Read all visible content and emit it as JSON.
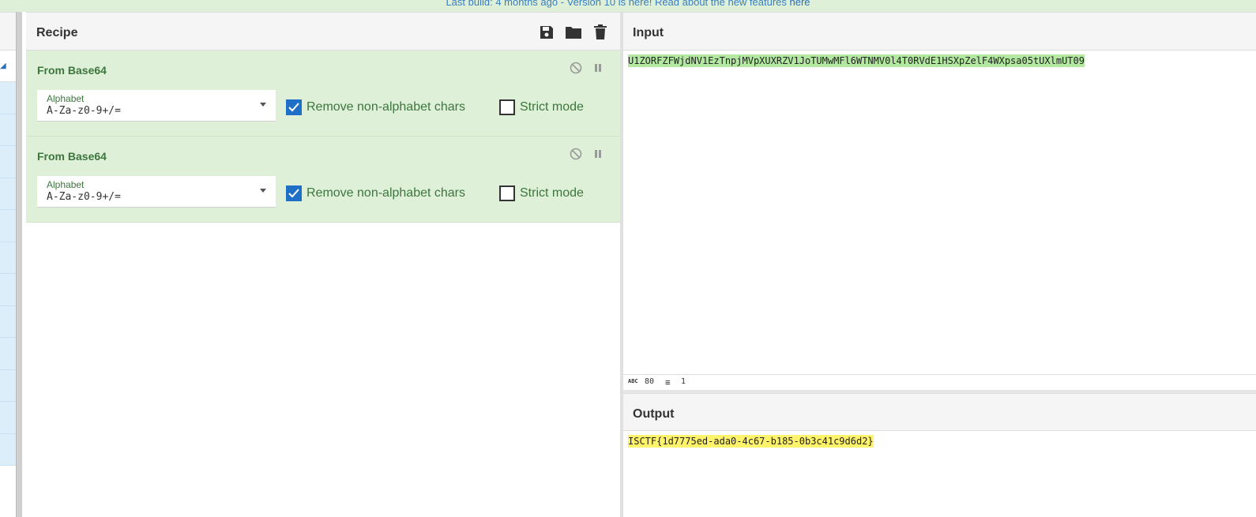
{
  "banner": {
    "text": "Last build: 4 months ago - Version 10 is here! Read about the new features ",
    "link": "here"
  },
  "recipe": {
    "title": "Recipe",
    "actions": [
      "save-icon",
      "folder-icon",
      "trash-icon"
    ],
    "operations": [
      {
        "name": "From Base64",
        "alphabet_label": "Alphabet",
        "alphabet_value": "A-Za-z0-9+/=",
        "remove_label": "Remove non-alphabet chars",
        "remove_checked": true,
        "strict_label": "Strict mode",
        "strict_checked": false
      },
      {
        "name": "From Base64",
        "alphabet_label": "Alphabet",
        "alphabet_value": "A-Za-z0-9+/=",
        "remove_label": "Remove non-alphabet chars",
        "remove_checked": true,
        "strict_label": "Strict mode",
        "strict_checked": false
      }
    ]
  },
  "input": {
    "title": "Input",
    "text": "U1ZORFZFWjdNV1EzTnpjMVpXUXRZV1JoTUMwMFl6WTNMV0l4T0RVdE1HSXpZelF4WXpsa05tUXlmUT09",
    "status": {
      "length": "80",
      "lines": "1"
    }
  },
  "output": {
    "title": "Output",
    "text": "ISCTF{1d7775ed-ada0-4c67-b185-0b3c41c9d6d2}"
  },
  "colors": {
    "op_background": "#dff0d8",
    "op_title": "#3c763d",
    "checkbox_on": "#1f6fc7",
    "input_highlight": "#b2e8a0",
    "output_highlight": "#fff36b"
  }
}
